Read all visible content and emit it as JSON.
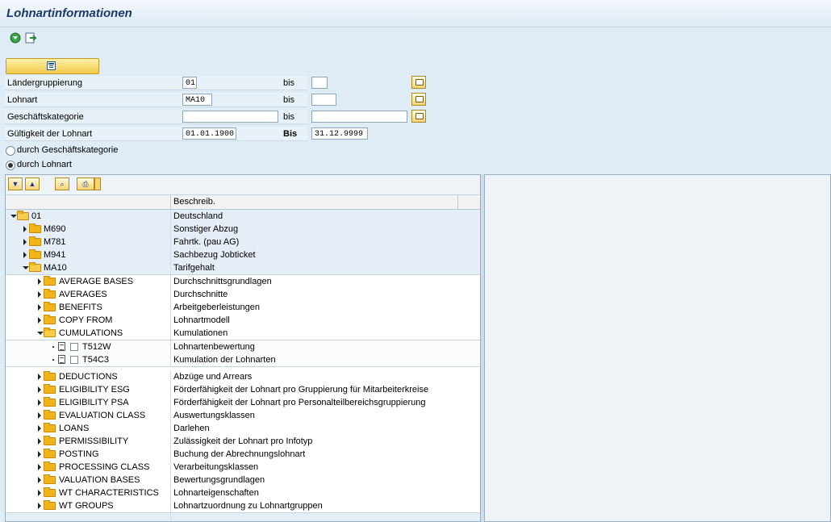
{
  "title": "Lohnartinformationen",
  "toolbar": {
    "icons": [
      "execute-icon",
      "variant-icon"
    ]
  },
  "selection": {
    "execute_icon": "tree-view-icon",
    "fields": [
      {
        "label": "Ländergruppierung",
        "from": "01",
        "bis_label": "bis",
        "to": ""
      },
      {
        "label": "Lohnart",
        "from": "MA10",
        "bis_label": "bis",
        "to": ""
      },
      {
        "label": "Geschäftskategorie",
        "from": "",
        "bis_label": "bis",
        "to": ""
      },
      {
        "label": "Gültigkeit der Lohnart",
        "from": "01.01.1900",
        "bis_label": "Bis",
        "to": "31.12.9999"
      }
    ],
    "radios": [
      {
        "label": "durch Geschäftskategorie",
        "selected": false
      },
      {
        "label": "durch Lohnart",
        "selected": true
      }
    ]
  },
  "tree": {
    "toolbar_icons": [
      "expand-all-icon",
      "collapse-all-icon",
      "find-icon",
      "print-icon"
    ],
    "header": {
      "col1": "",
      "col2": "Beschreib."
    },
    "rows": [
      {
        "name": "01",
        "desc": "Deutschland"
      },
      {
        "name": "M690",
        "desc": "Sonstiger Abzug"
      },
      {
        "name": "M781",
        "desc": "Fahrtk. (pau AG)"
      },
      {
        "name": "M941",
        "desc": "Sachbezug Jobticket"
      },
      {
        "name": "MA10",
        "desc": "Tarifgehalt"
      },
      {
        "name": "AVERAGE BASES",
        "desc": "Durchschnittsgrundlagen"
      },
      {
        "name": "AVERAGES",
        "desc": "Durchschnitte"
      },
      {
        "name": "BENEFITS",
        "desc": "Arbeitgeberleistungen"
      },
      {
        "name": "COPY FROM",
        "desc": "Lohnartmodell"
      },
      {
        "name": "CUMULATIONS",
        "desc": "Kumulationen"
      },
      {
        "name": "T512W",
        "desc": "Lohnartenbewertung"
      },
      {
        "name": "T54C3",
        "desc": "Kumulation der Lohnarten"
      },
      {
        "name": "DEDUCTIONS",
        "desc": "Abzüge und Arrears"
      },
      {
        "name": "ELIGIBILITY ESG",
        "desc": "Förderfähigkeit der Lohnart pro Gruppierung für Mitarbeiterkreise"
      },
      {
        "name": "ELIGIBILITY PSA",
        "desc": "Förderfähigkeit der Lohnart pro Personalteilbereichsgruppierung"
      },
      {
        "name": "EVALUATION CLASS",
        "desc": "Auswertungsklassen"
      },
      {
        "name": "LOANS",
        "desc": "Darlehen"
      },
      {
        "name": "PERMISSIBILITY",
        "desc": "Zulässigkeit der Lohnart pro Infotyp"
      },
      {
        "name": "POSTING",
        "desc": "Buchung der Abrechnungslohnart"
      },
      {
        "name": "PROCESSING CLASS",
        "desc": "Verarbeitungsklassen"
      },
      {
        "name": "VALUATION BASES",
        "desc": "Bewertungsgrundlagen"
      },
      {
        "name": "WT CHARACTERISTICS",
        "desc": "Lohnarteigenschaften"
      },
      {
        "name": "WT GROUPS",
        "desc": "Lohnartzuordnung zu Lohnartgruppen"
      }
    ]
  }
}
